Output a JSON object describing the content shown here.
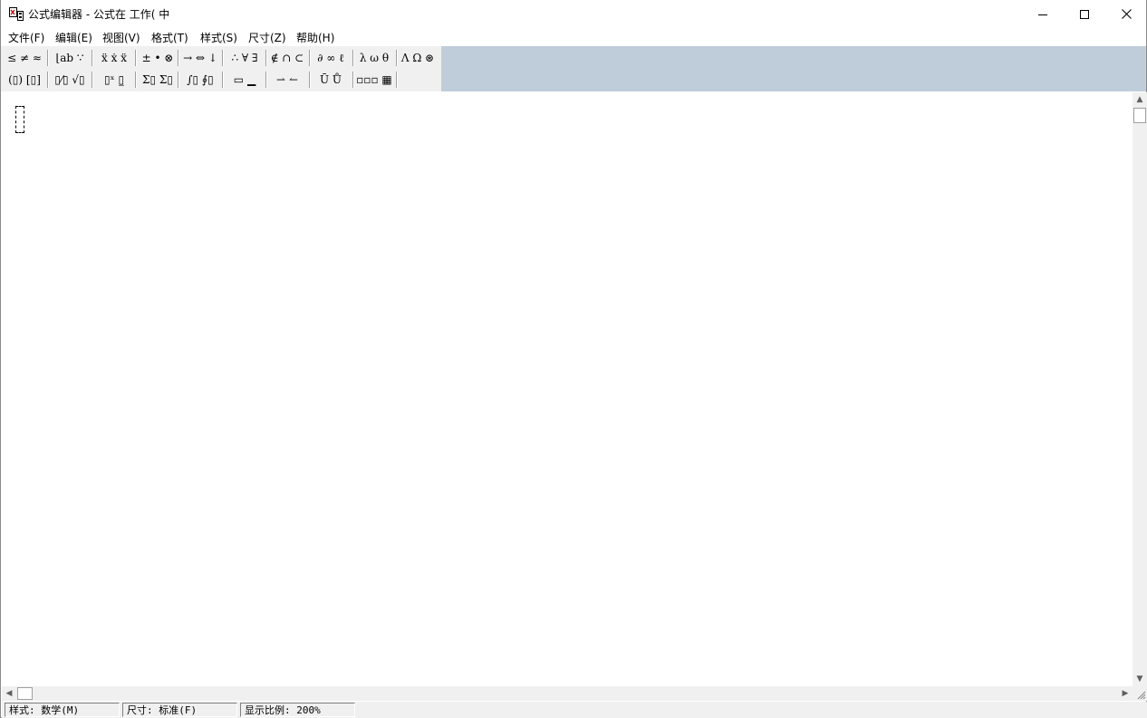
{
  "window": {
    "title": "公式编辑器 - 公式在 工作( 中"
  },
  "menu": [
    {
      "label": "文件(F)"
    },
    {
      "label": "编辑(E)"
    },
    {
      "label": "视图(V)"
    },
    {
      "label": "格式(T)"
    },
    {
      "label": "样式(S)"
    },
    {
      "label": "尺寸(Z)"
    },
    {
      "label": "帮助(H)"
    }
  ],
  "toolbar": {
    "row1": [
      {
        "glyph": "≤ ≠ ≈",
        "icon": "relational-symbols-icon"
      },
      {
        "glyph": "⌊ab ∵",
        "icon": "spaces-ellipses-icon"
      },
      {
        "glyph": "ẍ ẋ ẍ",
        "icon": "embellishments-icon"
      },
      {
        "glyph": "± • ⊗",
        "icon": "operator-symbols-icon"
      },
      {
        "glyph": "→ ⇔ ↓",
        "icon": "arrow-symbols-icon"
      },
      {
        "glyph": "∴ ∀ ∃",
        "icon": "logical-symbols-icon"
      },
      {
        "glyph": "∉ ∩ ⊂",
        "icon": "set-theory-symbols-icon"
      },
      {
        "glyph": "∂ ∞ ℓ",
        "icon": "misc-symbols-icon"
      },
      {
        "glyph": "λ ω θ",
        "icon": "greek-lowercase-icon"
      },
      {
        "glyph": "Λ Ω ⊛",
        "icon": "greek-uppercase-icon"
      }
    ],
    "row2": [
      {
        "glyph": "(▯) [▯]",
        "icon": "fence-templates-icon"
      },
      {
        "glyph": "▯⁄▯ √▯",
        "icon": "fraction-radical-templates-icon"
      },
      {
        "glyph": "▯ˣ ▯̲",
        "icon": "subscript-superscript-templates-icon"
      },
      {
        "glyph": "Σ▯ Σ▯",
        "icon": "summation-templates-icon"
      },
      {
        "glyph": "∫▯ ∮▯",
        "icon": "integral-templates-icon"
      },
      {
        "glyph": "▭ ▁",
        "icon": "underbar-overbar-templates-icon"
      },
      {
        "glyph": "⇀ ↼",
        "icon": "labeled-arrow-templates-icon"
      },
      {
        "glyph": "Ū Ů",
        "icon": "products-set-theory-templates-icon"
      },
      {
        "glyph": "▫▫▫ ▦",
        "icon": "matrix-templates-icon"
      }
    ]
  },
  "status": {
    "style": "样式: 数学(M)",
    "size": "尺寸: 标准(F)",
    "zoom": "显示比例: 200%"
  }
}
